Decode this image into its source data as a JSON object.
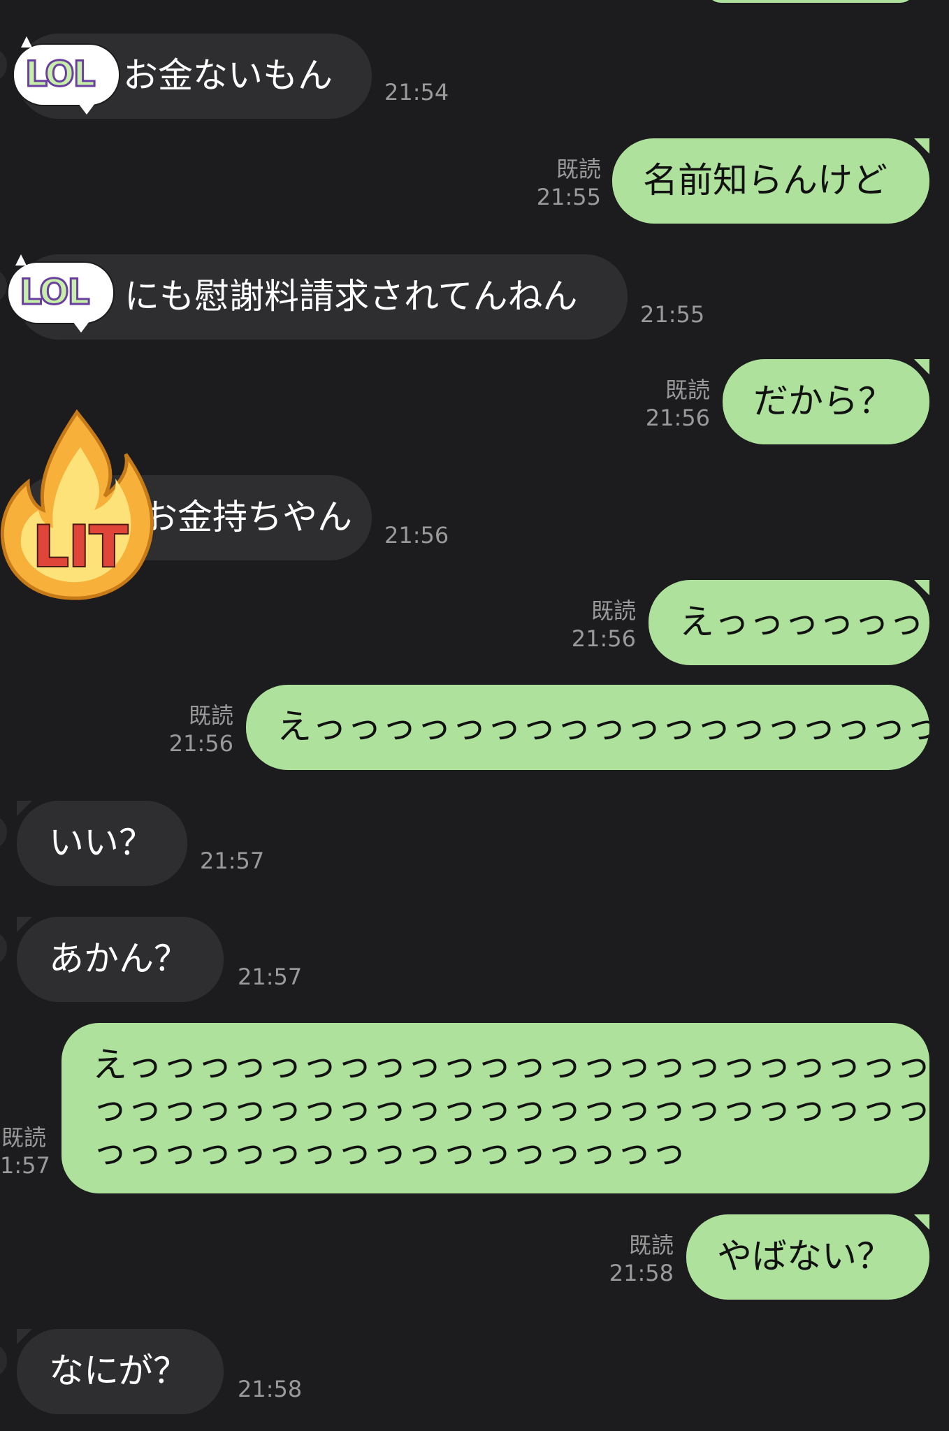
{
  "messages": [
    {
      "dir": "in",
      "text": "お金ないもん",
      "time": "21:54",
      "sticker": "lol-sticker"
    },
    {
      "dir": "out",
      "text": "名前知らんけど",
      "read": "既読",
      "time": "21:55"
    },
    {
      "dir": "in",
      "text": "にも慰謝料請求されてんねん",
      "time": "21:55",
      "sticker": "lol-sticker"
    },
    {
      "dir": "out",
      "text": "だから？",
      "read": "既読",
      "time": "21:56"
    },
    {
      "dir": "in",
      "text": "お金持ちやん",
      "time": "21:56",
      "sticker": "lit-fire-sticker"
    },
    {
      "dir": "out",
      "text": "えっっっっっっ",
      "read": "既読",
      "time": "21:56"
    },
    {
      "dir": "out",
      "text": "えっっっっっっっっっっっっっっっっっっっっっっっ",
      "read": "既読",
      "time": "21:56"
    },
    {
      "dir": "in",
      "text": "いい？",
      "time": "21:57"
    },
    {
      "dir": "in",
      "text": "あかん？",
      "time": "21:57"
    },
    {
      "dir": "out",
      "lines": [
        "えっっっっっっっっっっっっっっっっっっっっっっっ",
        "っっっっっっっっっっっっっっっっっっっっっっっっ",
        "っっっっっっっっっっっっっっっっっ"
      ],
      "read": "既読",
      "time": "1:57"
    },
    {
      "dir": "out",
      "text": "やばない？",
      "read": "既読",
      "time": "21:58"
    },
    {
      "dir": "in",
      "text": "なにが？",
      "time": "21:58"
    }
  ],
  "stickers": {
    "lol": "LOL",
    "lit": "LIT"
  },
  "colors": {
    "background": "#1c1c1e",
    "incoming_bubble": "#2e2e30",
    "outgoing_bubble": "#aee29c",
    "meta_text": "#9a9a9a"
  }
}
